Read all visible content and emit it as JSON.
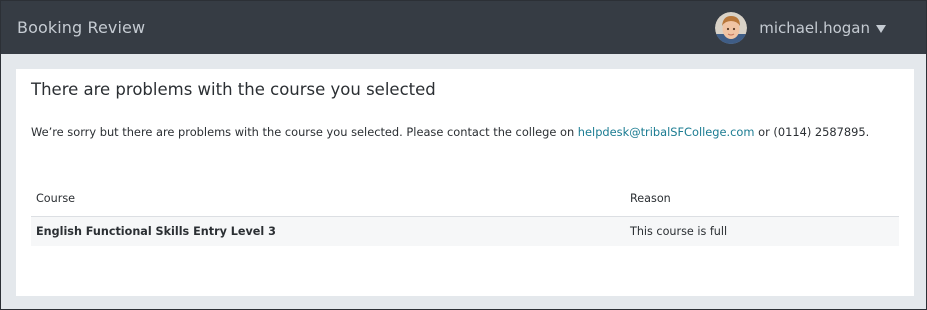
{
  "header": {
    "app_title": "Booking Review",
    "user": {
      "username": "michael.hogan",
      "avatar_icon": "user-avatar",
      "menu_icon": "caret-down-icon"
    }
  },
  "panel": {
    "title": "There are problems with the course you selected",
    "message": {
      "before_link": "We’re sorry but there are problems with the course you selected. Please contact the college on ",
      "email": "helpdesk@tribalSFCollege.com",
      "after_link": " or (0114) 2587895."
    },
    "table": {
      "columns": [
        "Course",
        "Reason"
      ],
      "rows": [
        {
          "course": "English Functional Skills Entry Level 3",
          "reason": "This course is full"
        }
      ]
    }
  },
  "colors": {
    "topbar": "#363c44",
    "background": "#e4e8ec",
    "link": "#1b7c92"
  }
}
